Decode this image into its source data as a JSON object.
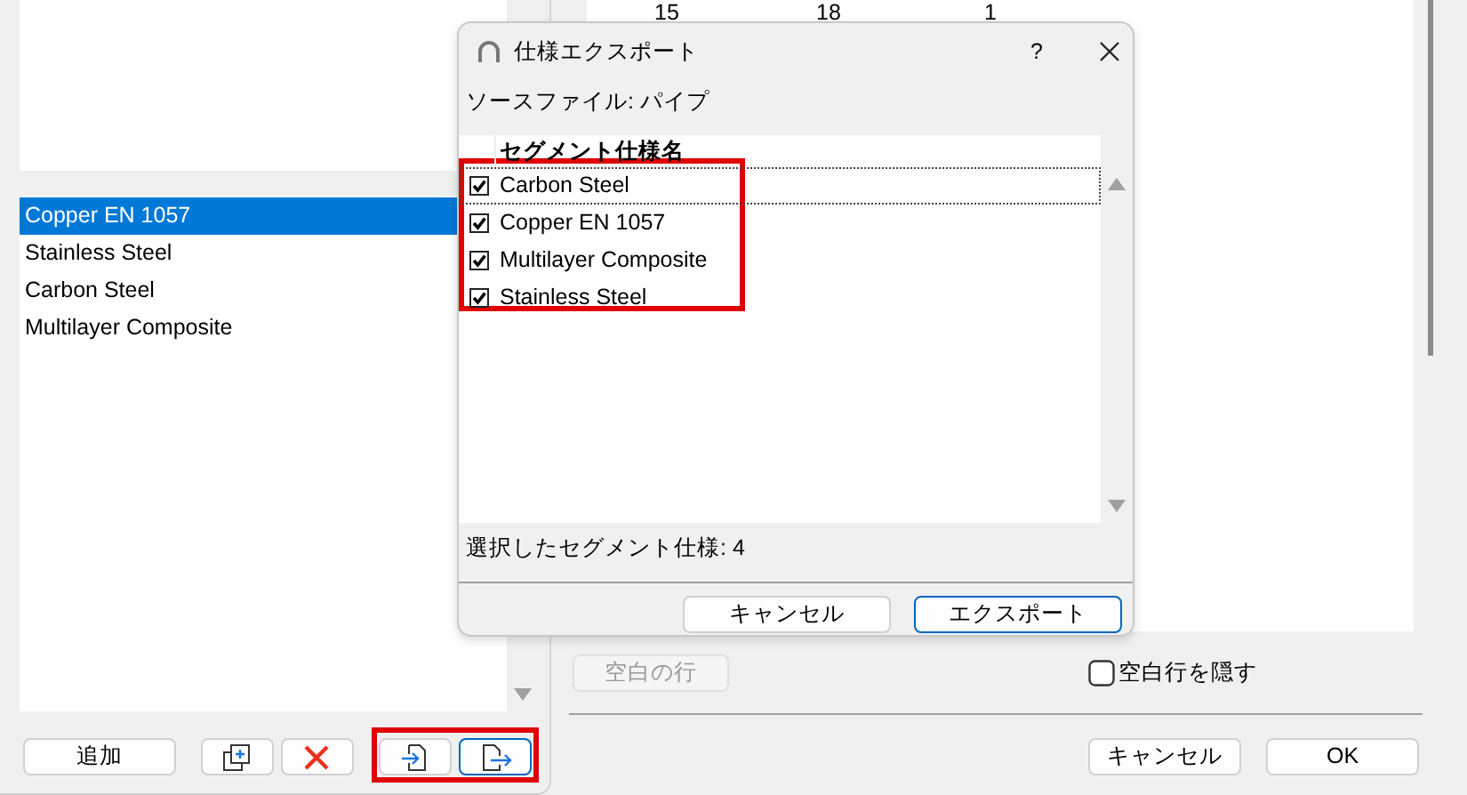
{
  "spec_list": [
    {
      "label": "Copper EN 1057",
      "selected": true
    },
    {
      "label": "Stainless Steel",
      "selected": false
    },
    {
      "label": "Carbon Steel",
      "selected": false
    },
    {
      "label": "Multilayer Composite",
      "selected": false
    }
  ],
  "list_buttons": [
    {
      "kind": "text",
      "label": "追加",
      "focused": false
    },
    {
      "kind": "duplicate",
      "focused": false
    },
    {
      "kind": "delete",
      "focused": false
    },
    {
      "kind": "import",
      "focused": false
    },
    {
      "kind": "export",
      "focused": true
    }
  ],
  "column_numbers": [
    "15",
    "18",
    "1"
  ],
  "blank_row_button": {
    "label": "空白の行",
    "disabled": true
  },
  "hide_blank_rows": {
    "label": "空白行を隠す",
    "checked": false
  },
  "footer_buttons": [
    {
      "label": "キャンセル"
    },
    {
      "label": "OK"
    }
  ],
  "dialog": {
    "title": "仕様エクスポート",
    "help": "?",
    "source": "ソースファイル: パイプ",
    "column": "セグメント仕様名",
    "rows": [
      {
        "name": "Carbon Steel",
        "checked": true,
        "focused": true
      },
      {
        "name": "Copper EN 1057",
        "checked": true,
        "focused": false
      },
      {
        "name": "Multilayer Composite",
        "checked": true,
        "focused": false
      },
      {
        "name": "Stainless Steel",
        "checked": true,
        "focused": false
      }
    ],
    "status": "選択したセグメント仕様: 4",
    "buttons": [
      {
        "label": "キャンセル",
        "default": false
      },
      {
        "label": "エクスポート",
        "default": true
      }
    ]
  }
}
